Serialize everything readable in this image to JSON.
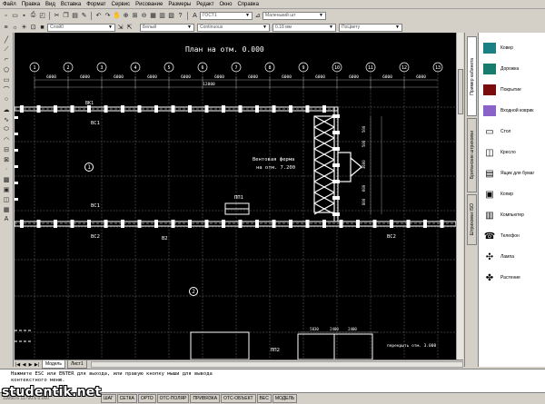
{
  "menu": [
    "Файл",
    "Правка",
    "Вид",
    "Вставка",
    "Формат",
    "Сервис",
    "Рисование",
    "Размеры",
    "Редакт",
    "Окно",
    "Справка"
  ],
  "toolbar": {
    "style_combo": "ГОСТ1",
    "text_style_combo": "Маленький шт",
    "layer_combo": "Слой0",
    "color_combo": "Белый",
    "linetype_combo": "Continuous",
    "lineweight_combo": "0.18 мм",
    "plotstyle_combo": "ПоЦвету"
  },
  "drawing": {
    "title": "План на отм. 0.000",
    "truss_label_1": "Вентовая ферма",
    "truss_label_2": "на отм. 7.200",
    "dims": [
      "6000",
      "6000",
      "6000",
      "6000",
      "6000",
      "6000",
      "6000",
      "6000",
      "6000",
      "6000",
      "6000",
      "6000"
    ],
    "dim_mid": "12000",
    "side_dims": [
      "500",
      "500",
      "3600",
      "600",
      "800"
    ],
    "room_1": "1",
    "room_2": "2",
    "tags": {
      "vk1": "ВК1",
      "bs1": "ВС1",
      "bs2": "ВС2",
      "pp1": "ПП1",
      "v2": "В2",
      "pp2": "ПП2"
    },
    "note": "перекрыть отм. 3.000",
    "bottom_dims": [
      "5830",
      "2400",
      "2400"
    ]
  },
  "tabs": {
    "model": "Модель",
    "layout": "Лист1"
  },
  "side_tabs": [
    "Пример кабинета",
    "Британские штриховки",
    "Штриховки ISO"
  ],
  "palette": {
    "accent": "#1c7f7f",
    "items": [
      {
        "label": "Ковер",
        "type": "swatch",
        "color": "#1b7f86"
      },
      {
        "label": "Дорожка",
        "type": "swatch",
        "color": "#177b6d"
      },
      {
        "label": "Покрытие",
        "type": "swatch",
        "color": "#7a0c0c"
      },
      {
        "label": "Входной коврик",
        "type": "swatch",
        "color": "#8a63c8"
      },
      {
        "label": "Стол",
        "type": "icon",
        "icon": "table-icon"
      },
      {
        "label": "Кресло",
        "type": "icon",
        "icon": "chair-icon"
      },
      {
        "label": "Ящик для бумаг",
        "type": "icon",
        "icon": "file-box-icon"
      },
      {
        "label": "Копир",
        "type": "icon",
        "icon": "copier-icon"
      },
      {
        "label": "Компьютер",
        "type": "icon",
        "icon": "computer-icon"
      },
      {
        "label": "Телефон",
        "type": "icon",
        "icon": "phone-icon"
      },
      {
        "label": "Лампа",
        "type": "icon",
        "icon": "lamp-icon"
      },
      {
        "label": "Растение",
        "type": "icon",
        "icon": "plant-icon"
      }
    ]
  },
  "command": {
    "line1": "Нажмите ESC или ENTER для выхода, или правую кнопку мыши для вывода",
    "line2": "контекстного меню."
  },
  "status": {
    "coords": "10050.6 11790.6 0.000",
    "buttons": [
      "ШАГ",
      "СЕТКА",
      "ОРТО",
      "ОТС-ПОЛЯР",
      "ПРИВЯЗКА",
      "ОТС-ОБЪЕКТ",
      "ВЕС",
      "МОДЕЛЬ"
    ]
  },
  "watermark": "studentik.net"
}
